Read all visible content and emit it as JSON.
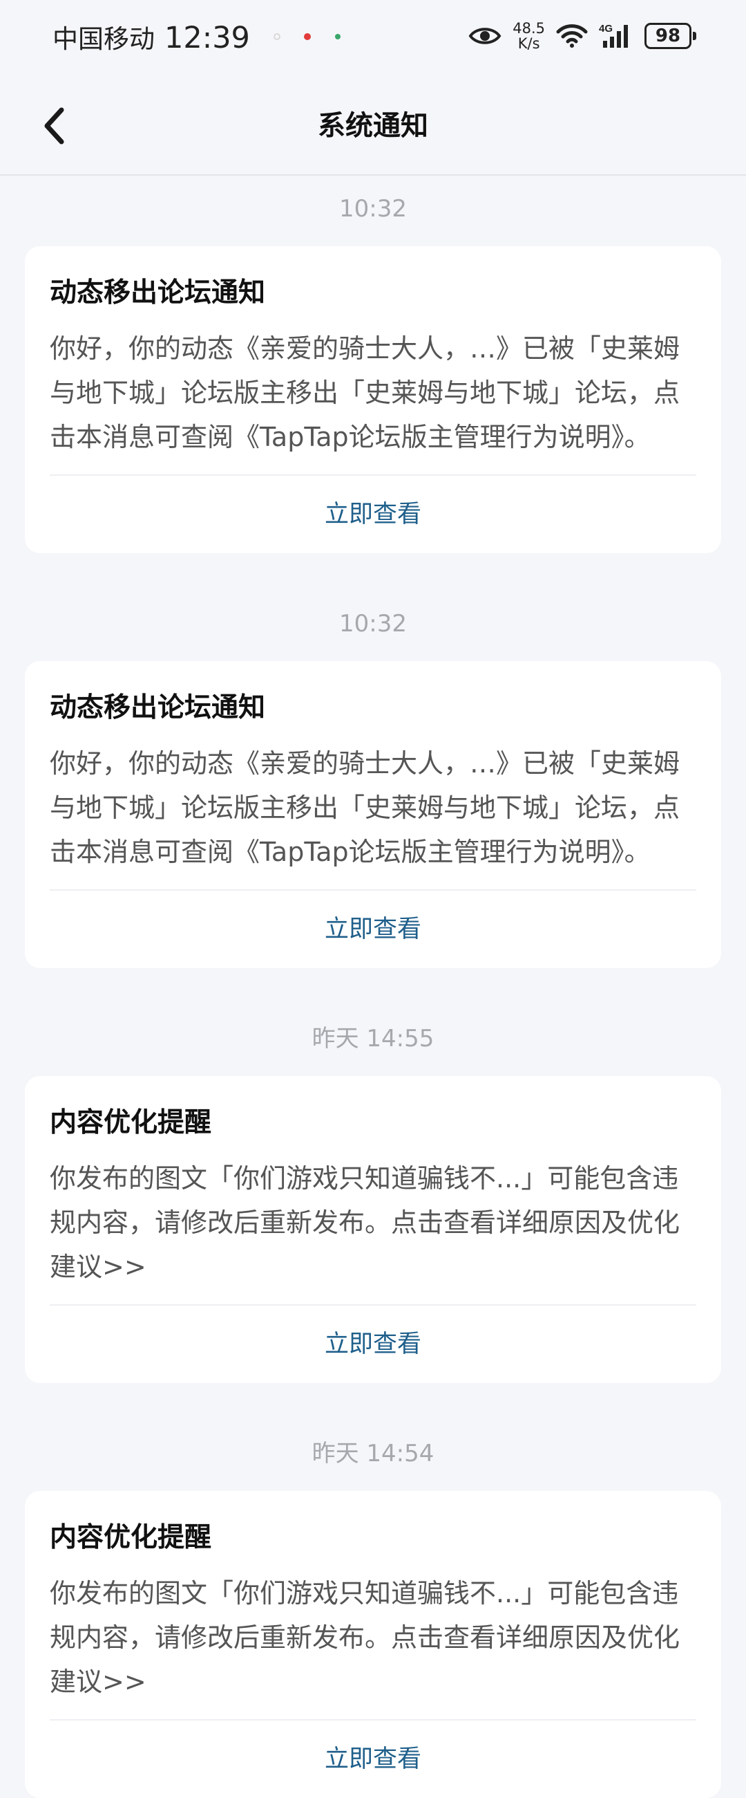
{
  "status_bar": {
    "carrier": "中国移动",
    "time": "12:39",
    "net_speed_value": "48.5",
    "net_speed_unit": "K/s",
    "network_type": "4G",
    "battery": "98"
  },
  "header": {
    "title": "系统通知"
  },
  "notifications": [
    {
      "time": "10:32",
      "title": "动态移出论坛通知",
      "body": "你好，你的动态《亲爱的骑士大人，…》已被「史莱姆与地下城」论坛版主移出「史莱姆与地下城」论坛，点击本消息可查阅《TapTap论坛版主管理行为说明》。",
      "action": "立即查看"
    },
    {
      "time": "10:32",
      "title": "动态移出论坛通知",
      "body": "你好，你的动态《亲爱的骑士大人，…》已被「史莱姆与地下城」论坛版主移出「史莱姆与地下城」论坛，点击本消息可查阅《TapTap论坛版主管理行为说明》。",
      "action": "立即查看"
    },
    {
      "time": "昨天  14:55",
      "title": "内容优化提醒",
      "body": "你发布的图文「你们游戏只知道骗钱不...」可能包含违规内容，请修改后重新发布。点击查看详细原因及优化建议>>",
      "action": "立即查看"
    },
    {
      "time": "昨天  14:54",
      "title": "内容优化提醒",
      "body": "你发布的图文「你们游戏只知道骗钱不...」可能包含违规内容，请修改后重新发布。点击查看详细原因及优化建议>>",
      "action": "立即查看"
    }
  ]
}
